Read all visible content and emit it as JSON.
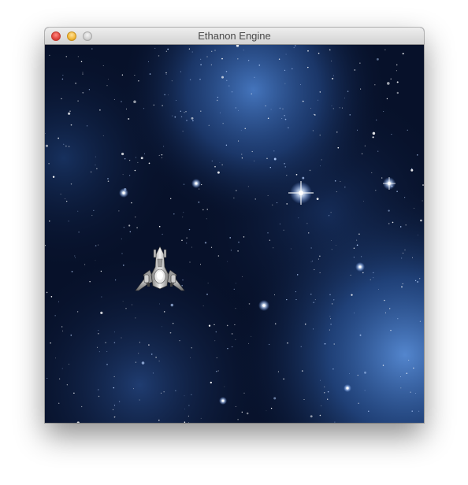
{
  "window": {
    "title": "Ethanon Engine",
    "controls": [
      "close",
      "minimize",
      "zoom"
    ]
  },
  "scene": {
    "background": "starfield-nebula",
    "sprites": [
      "player-spaceship"
    ]
  },
  "colors": {
    "space_dark": "#07112a",
    "nebula_blue": "#3a6bb8",
    "star": "#ffffff",
    "titlebar": "#dcdcdc",
    "close": "#e0443e",
    "minimize": "#f2b83a",
    "zoom": "#d2d2d2"
  }
}
